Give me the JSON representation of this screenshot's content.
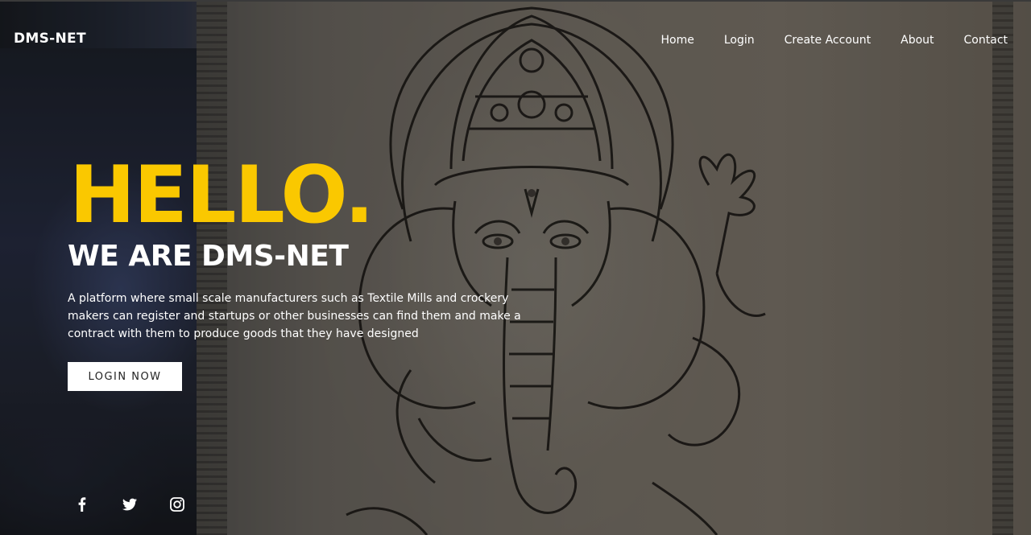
{
  "brand": {
    "name": "DMS-NET"
  },
  "nav": {
    "items": [
      {
        "label": "Home"
      },
      {
        "label": "Login"
      },
      {
        "label": "Create Account"
      },
      {
        "label": "About"
      },
      {
        "label": "Contact"
      }
    ]
  },
  "hero": {
    "headline": "HELLO.",
    "subtitle": "WE ARE DMS-NET",
    "description": "A platform where small scale manufacturers such as Textile Mills and crockery makers can register and startups or other businesses can find them and make a contract with them to produce goods that they have designed",
    "cta_label": "LOGIN NOW"
  },
  "social": {
    "icons": [
      "facebook-icon",
      "twitter-icon",
      "instagram-icon"
    ]
  },
  "colors": {
    "accent": "#fac800",
    "text": "#ffffff",
    "button_bg": "#ffffff",
    "button_text": "#222222"
  }
}
